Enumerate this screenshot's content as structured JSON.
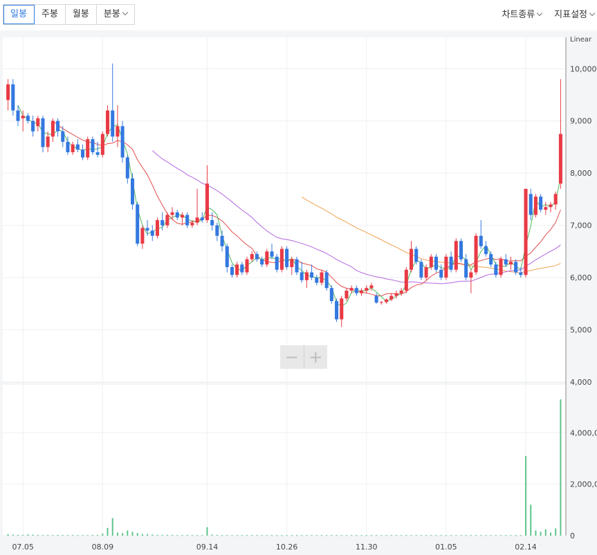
{
  "toolbar": {
    "tabs": [
      "일봉",
      "주봉",
      "월봉",
      "분봉"
    ],
    "active_tab": "일봉",
    "chart_type_label": "차트종류",
    "indicator_label": "지표설정"
  },
  "zoom": {
    "minus": "−",
    "plus": "+"
  },
  "colors": {
    "up": "#e83a45",
    "down": "#3478e0",
    "ma5": "#4cba5a",
    "ma20": "#e24b4b",
    "ma60": "#b266e0",
    "ma120": "#f0a050",
    "volume": "#5cc48a"
  },
  "chart_data": {
    "type": "candlestick",
    "scale_label": "Linear",
    "price_ticks": [
      "4,000",
      "5,000",
      "6,000",
      "7,000",
      "8,000",
      "9,000",
      "10,000"
    ],
    "volume_ticks": [
      "0",
      "2,000,00",
      "4,000,00"
    ],
    "x_tick_labels": [
      "07.05",
      "08.09",
      "09.14",
      "10.26",
      "11.30",
      "01.05",
      "02.14"
    ],
    "ylim": [
      4000,
      10600
    ],
    "volume_max": 5600000,
    "candles": [
      [
        9400,
        9800,
        9200,
        9700
      ],
      [
        9700,
        9800,
        9100,
        9200
      ],
      [
        9200,
        9300,
        8900,
        9000
      ],
      [
        9050,
        9200,
        8800,
        9100
      ],
      [
        9100,
        9150,
        8950,
        9000
      ],
      [
        9000,
        9100,
        8700,
        8800
      ],
      [
        8900,
        9100,
        8800,
        9050
      ],
      [
        9050,
        9100,
        8400,
        8500
      ],
      [
        8500,
        8800,
        8400,
        8700
      ],
      [
        8700,
        9050,
        8600,
        9000
      ],
      [
        9000,
        9050,
        8700,
        8800
      ],
      [
        8800,
        8900,
        8500,
        8600
      ],
      [
        8600,
        8700,
        8350,
        8400
      ],
      [
        8400,
        8600,
        8350,
        8550
      ],
      [
        8550,
        8650,
        8400,
        8450
      ],
      [
        8450,
        8550,
        8250,
        8300
      ],
      [
        8300,
        8700,
        8250,
        8650
      ],
      [
        8650,
        8700,
        8350,
        8400
      ],
      [
        8400,
        8600,
        8300,
        8350
      ],
      [
        8350,
        8800,
        8300,
        8750
      ],
      [
        8750,
        9300,
        8700,
        9200
      ],
      [
        9200,
        10100,
        8600,
        8700
      ],
      [
        8700,
        9300,
        8500,
        8900
      ],
      [
        8900,
        9000,
        8200,
        8300
      ],
      [
        8300,
        8350,
        7800,
        7900
      ],
      [
        7900,
        8000,
        7300,
        7400
      ],
      [
        7400,
        7450,
        6600,
        6650
      ],
      [
        6650,
        7000,
        6550,
        6950
      ],
      [
        6950,
        7100,
        6800,
        6900
      ],
      [
        6900,
        7000,
        6700,
        6800
      ],
      [
        6800,
        7150,
        6750,
        7100
      ],
      [
        7100,
        7250,
        6900,
        7000
      ],
      [
        7000,
        7250,
        6950,
        7200
      ],
      [
        7200,
        7350,
        7100,
        7250
      ],
      [
        7250,
        7300,
        7100,
        7150
      ],
      [
        7150,
        7250,
        7000,
        7200
      ],
      [
        7200,
        7250,
        6950,
        7000
      ],
      [
        7000,
        7100,
        6950,
        7050
      ],
      [
        7050,
        7700,
        7000,
        7150
      ],
      [
        7150,
        7250,
        7050,
        7100
      ],
      [
        7100,
        8150,
        7050,
        7800
      ],
      [
        7100,
        7250,
        6900,
        7000
      ],
      [
        7000,
        7050,
        6700,
        6800
      ],
      [
        6800,
        6900,
        6500,
        6600
      ],
      [
        6600,
        6650,
        6100,
        6200
      ],
      [
        6200,
        6250,
        6000,
        6050
      ],
      [
        6050,
        6300,
        6000,
        6250
      ],
      [
        6250,
        6300,
        6050,
        6100
      ],
      [
        6100,
        6400,
        6050,
        6350
      ],
      [
        6350,
        6500,
        6300,
        6450
      ],
      [
        6450,
        6500,
        6300,
        6350
      ],
      [
        6350,
        6400,
        6200,
        6250
      ],
      [
        6250,
        6550,
        6200,
        6500
      ],
      [
        6500,
        6650,
        6350,
        6400
      ],
      [
        6400,
        6450,
        6100,
        6150
      ],
      [
        6150,
        6600,
        6100,
        6550
      ],
      [
        6550,
        6600,
        6150,
        6200
      ],
      [
        6200,
        6400,
        6050,
        6350
      ],
      [
        6350,
        6400,
        6050,
        6100
      ],
      [
        6100,
        6300,
        5900,
        5950
      ],
      [
        5950,
        6150,
        5800,
        6100
      ],
      [
        6100,
        6250,
        5950,
        6000
      ],
      [
        6000,
        6050,
        5850,
        5900
      ],
      [
        5900,
        6150,
        5850,
        6100
      ],
      [
        6100,
        6150,
        5750,
        5800
      ],
      [
        5800,
        5850,
        5500,
        5550
      ],
      [
        5550,
        5600,
        5150,
        5200
      ],
      [
        5200,
        5650,
        5050,
        5600
      ],
      [
        5600,
        5800,
        5550,
        5750
      ],
      [
        5750,
        5850,
        5700,
        5800
      ],
      [
        5800,
        5850,
        5650,
        5700
      ],
      [
        5700,
        5800,
        5650,
        5750
      ],
      [
        5750,
        5850,
        5700,
        5800
      ],
      [
        5800,
        5900,
        5750,
        5850
      ],
      [
        5650,
        5700,
        5500,
        5520
      ],
      [
        5520,
        5550,
        5480,
        5530
      ],
      [
        5530,
        5600,
        5500,
        5580
      ],
      [
        5580,
        5700,
        5550,
        5650
      ],
      [
        5650,
        5750,
        5600,
        5700
      ],
      [
        5700,
        5800,
        5650,
        5750
      ],
      [
        5750,
        6200,
        5700,
        6150
      ],
      [
        6150,
        6700,
        6100,
        6550
      ],
      [
        6550,
        6600,
        6250,
        6300
      ],
      [
        6300,
        6350,
        5950,
        6000
      ],
      [
        6000,
        6250,
        5950,
        6200
      ],
      [
        6200,
        6450,
        6150,
        6400
      ],
      [
        6400,
        6450,
        6100,
        6150
      ],
      [
        6150,
        6250,
        5950,
        6000
      ],
      [
        6000,
        6450,
        5950,
        6400
      ],
      [
        6400,
        6500,
        6100,
        6150
      ],
      [
        6150,
        6750,
        6100,
        6700
      ],
      [
        6700,
        6750,
        6300,
        6350
      ],
      [
        6350,
        6450,
        5950,
        6000
      ],
      [
        6000,
        6150,
        5700,
        6100
      ],
      [
        6100,
        6850,
        6050,
        6800
      ],
      [
        6800,
        7100,
        6550,
        6600
      ],
      [
        6600,
        6700,
        6400,
        6450
      ],
      [
        6450,
        6500,
        6200,
        6250
      ],
      [
        6250,
        6300,
        6000,
        6050
      ],
      [
        6050,
        6400,
        6000,
        6350
      ],
      [
        6350,
        6450,
        6200,
        6250
      ],
      [
        6250,
        6400,
        6150,
        6300
      ],
      [
        6300,
        6350,
        6050,
        6100
      ],
      [
        6100,
        6200,
        6000,
        6050
      ],
      [
        6050,
        7000,
        6000,
        7700
      ],
      [
        7600,
        7700,
        7100,
        7200
      ],
      [
        7200,
        7600,
        7150,
        7550
      ],
      [
        7550,
        7600,
        7250,
        7300
      ],
      [
        7300,
        7450,
        7200,
        7350
      ],
      [
        7350,
        7450,
        7250,
        7400
      ],
      [
        7400,
        7650,
        7300,
        7600
      ],
      [
        7800,
        9800,
        7700,
        8750
      ]
    ],
    "volumes": [
      60000,
      40000,
      30000,
      30000,
      50000,
      40000,
      30000,
      20000,
      30000,
      20000,
      30000,
      20000,
      20000,
      20000,
      20000,
      20000,
      20000,
      30000,
      30000,
      80000,
      300000,
      680000,
      120000,
      100000,
      200000,
      150000,
      100000,
      60000,
      60000,
      40000,
      30000,
      30000,
      30000,
      30000,
      20000,
      20000,
      30000,
      20000,
      20000,
      20000,
      330000,
      40000,
      30000,
      20000,
      20000,
      20000,
      20000,
      20000,
      20000,
      20000,
      20000,
      20000,
      20000,
      20000,
      20000,
      20000,
      20000,
      20000,
      20000,
      20000,
      20000,
      20000,
      20000,
      20000,
      20000,
      20000,
      20000,
      20000,
      20000,
      20000,
      20000,
      20000,
      20000,
      20000,
      20000,
      20000,
      20000,
      20000,
      20000,
      20000,
      20000,
      20000,
      20000,
      20000,
      20000,
      20000,
      20000,
      20000,
      20000,
      20000,
      20000,
      20000,
      20000,
      20000,
      20000,
      20000,
      20000,
      20000,
      20000,
      20000,
      20000,
      20000,
      20000,
      20000,
      3100000,
      1200000,
      200000,
      150000,
      250000,
      120000,
      280000,
      5300000
    ]
  }
}
